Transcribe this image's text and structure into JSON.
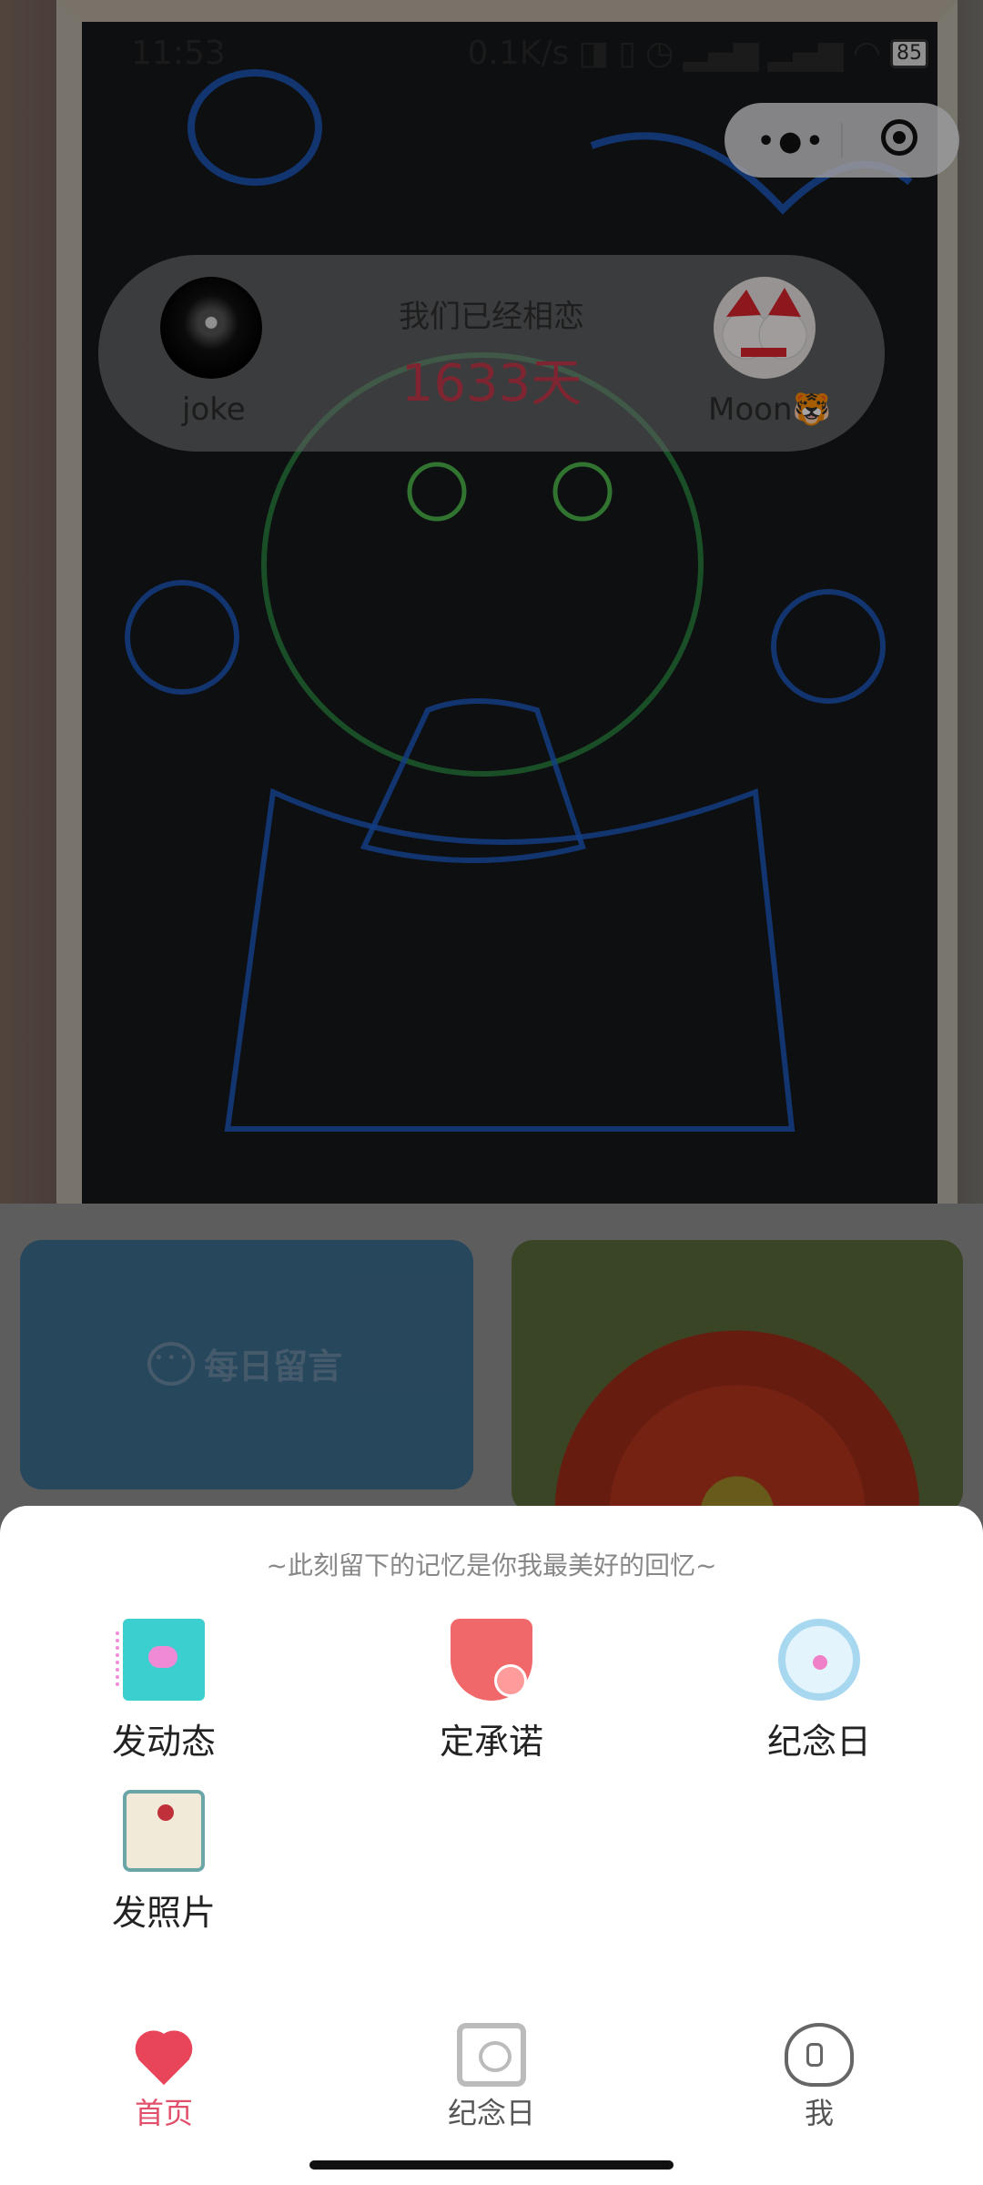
{
  "status_bar": {
    "time": "11:53",
    "network_speed": "0.1K/s",
    "battery": "85"
  },
  "couple_card": {
    "left_name": "joke",
    "right_name": "Moon🐯",
    "together_label": "我们已经相恋",
    "days": "1633天"
  },
  "tiles": {
    "daily_message": "每日留言"
  },
  "sheet": {
    "hint": "~此刻留下的记忆是你我最美好的回忆~",
    "actions": [
      {
        "label": "发动态",
        "icon": "notebook-icon"
      },
      {
        "label": "定承诺",
        "icon": "shield-icon"
      },
      {
        "label": "纪念日",
        "icon": "clock-icon"
      },
      {
        "label": "发照片",
        "icon": "easel-icon"
      }
    ]
  },
  "tabbar": {
    "tabs": [
      {
        "label": "首页",
        "icon": "heart-icon",
        "active": true
      },
      {
        "label": "纪念日",
        "icon": "calendar-icon",
        "active": false
      },
      {
        "label": "我",
        "icon": "lock-heart-icon",
        "active": false
      }
    ]
  },
  "colors": {
    "accent": "#e0506a",
    "days_color": "#c43a4d",
    "tile_blue": "#3d6d8f"
  }
}
